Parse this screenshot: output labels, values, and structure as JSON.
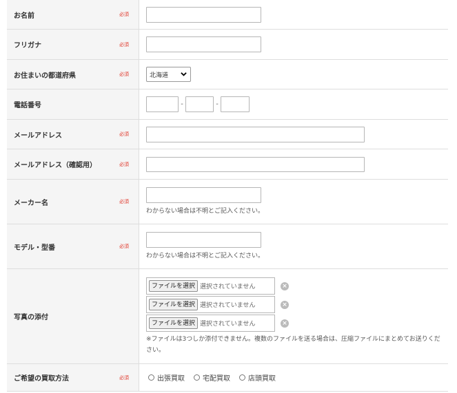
{
  "required_label": "必須",
  "fields": {
    "name": {
      "label": "お名前"
    },
    "furigana": {
      "label": "フリガナ"
    },
    "prefecture": {
      "label": "お住まいの都道府県",
      "value": "北海道"
    },
    "phone": {
      "label": "電話番号",
      "sep1": "-",
      "sep2": "-"
    },
    "email": {
      "label": "メールアドレス"
    },
    "email_confirm": {
      "label": "メールアドレス（確認用）"
    },
    "maker": {
      "label": "メーカー名",
      "note": "わからない場合は不明とご記入ください。"
    },
    "model": {
      "label": "モデル・型番",
      "note": "わからない場合は不明とご記入ください。"
    },
    "photos": {
      "label": "写真の添付",
      "files": [
        {
          "button": "ファイルを選択",
          "status": "選択されていません"
        },
        {
          "button": "ファイルを選択",
          "status": "選択されていません"
        },
        {
          "button": "ファイルを選択",
          "status": "選択されていません"
        }
      ],
      "note": "※ファイルは3つしか添付できません。複数のファイルを送る場合は、圧縮ファイルにまとめてお送りください。"
    },
    "purchase_method": {
      "label": "ご希望の買取方法",
      "options": [
        "出張買取",
        "宅配買取",
        "店頭買取"
      ]
    }
  }
}
